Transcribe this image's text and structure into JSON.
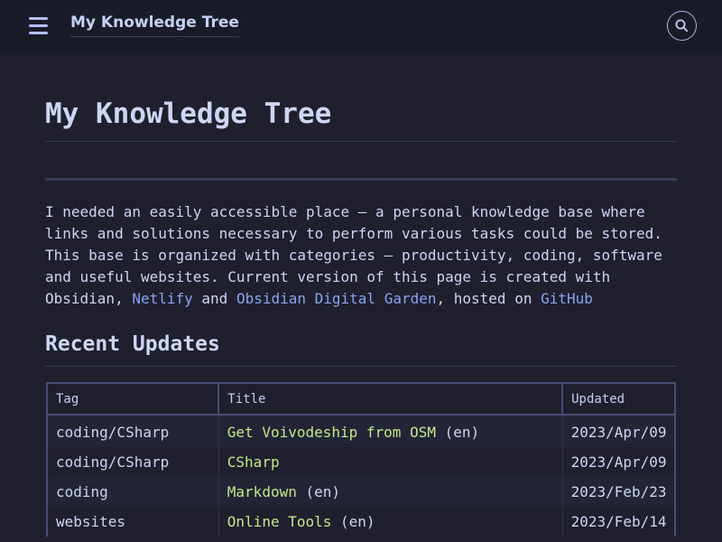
{
  "header": {
    "site_title": "My Knowledge Tree",
    "menu_icon": "hamburger-menu-icon",
    "search_icon": "search-icon"
  },
  "page": {
    "title": "My Knowledge Tree",
    "intro": {
      "text_1": "I needed an easily accessible place – a personal knowledge base where\nlinks and solutions necessary to perform various tasks could be stored.\nThis base is organized with categories – productivity, coding, software\nand useful websites. Current version of this page is created with\nObsidian, ",
      "link_netlify": "Netlify",
      "text_2": " and ",
      "link_digital_garden": "Obsidian Digital Garden",
      "text_3": ", hosted on ",
      "link_github": "GitHub"
    }
  },
  "recent_updates": {
    "heading": "Recent Updates",
    "columns": [
      "Tag",
      "Title",
      "Updated"
    ],
    "rows": [
      {
        "tag": "coding/CSharp",
        "title": "Get Voivodeship from OSM",
        "suffix": " (en)",
        "updated": "2023/Apr/09"
      },
      {
        "tag": "coding/CSharp",
        "title": "CSharp",
        "suffix": "",
        "updated": "2023/Apr/09"
      },
      {
        "tag": "coding",
        "title": "Markdown",
        "suffix": " (en)",
        "updated": "2023/Feb/23"
      },
      {
        "tag": "websites",
        "title": "Online Tools",
        "suffix": " (en)",
        "updated": "2023/Feb/14"
      }
    ]
  },
  "colors": {
    "background": "#1f1f2e",
    "header_background": "#1a1b28",
    "text": "#cdd6f4",
    "link": "#89a4f0",
    "table_title_link": "#c4e88a",
    "table_border": "#4a4d75"
  }
}
